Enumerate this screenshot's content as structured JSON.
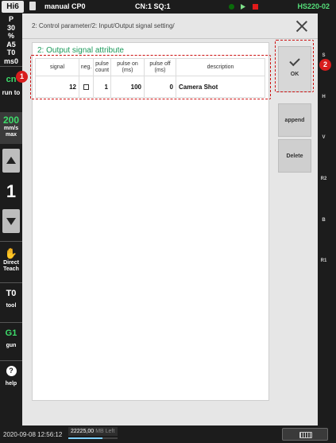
{
  "topbar": {
    "logo": "Hi6",
    "mode": "manual",
    "cp": "CP0",
    "cn_sq": "CN:1 SQ:1",
    "model": "HS220-02"
  },
  "leftbar": {
    "status_lines": [
      "P",
      "30",
      "%",
      "A5",
      "T0",
      "ms0"
    ],
    "cn_label": "cn",
    "cn_sub": "run to",
    "speed_value": "200",
    "speed_unit_1": "mm/s",
    "speed_unit_2": "max",
    "step_value": "1",
    "direct_teach_1": "Direct",
    "direct_teach_2": "Teach",
    "tool_value": "T0",
    "tool_label": "tool",
    "gun_value": "G1",
    "gun_label": "gun",
    "help_symbol": "?",
    "help_label": "help"
  },
  "rightbar": {
    "labels": [
      "S",
      "H",
      "V",
      "R2",
      "B",
      "R1"
    ]
  },
  "main": {
    "breadcrumb": "2: Control parameter/2: Input/Output signal setting/",
    "section_title": "2: Output signal attribute",
    "table": {
      "headers": {
        "signal": "signal",
        "neg": "neg.",
        "pulse_count_1": "pulse",
        "pulse_count_2": "count",
        "pulse_on_1": "pulse on",
        "pulse_on_2": "(ms)",
        "pulse_off_1": "pulse off",
        "pulse_off_2": "(ms)",
        "description": "description"
      },
      "rows": [
        {
          "signal": "12",
          "neg": false,
          "pulse_count": "1",
          "pulse_on": "100",
          "pulse_off": "0",
          "description": "Camera Shot"
        }
      ]
    },
    "buttons": {
      "ok": "OK",
      "append": "append",
      "delete": "Delete"
    }
  },
  "bottombar": {
    "datetime": "2020-09-08 12:56:12",
    "mem_value": "22225,00",
    "mem_label": "MB Left",
    "mem_fraction": 0.7
  },
  "annotations": {
    "badge_1": "1",
    "badge_2": "2"
  },
  "colors": {
    "accent_green": "#3ddc6a",
    "section_title": "#1a9a5a",
    "annotation_red": "#cc1111",
    "model_text": "#55e07a"
  }
}
